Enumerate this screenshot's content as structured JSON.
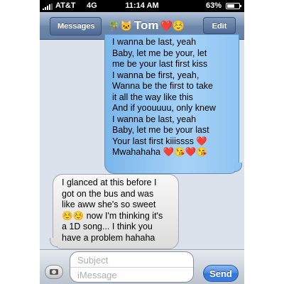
{
  "status_bar": {
    "carrier": "AT&T",
    "network": "4G",
    "time": "11:14 AM",
    "battery_percent": "63%",
    "battery_level": 0.63
  },
  "nav": {
    "back_label": "Messages",
    "title_prefix_emoji": "🎋🐱",
    "title": "Tom",
    "title_suffix_emoji": "❤️☺️",
    "edit_label": "Edit"
  },
  "messages": [
    {
      "direction": "sent",
      "text": "I wanna be last, yeah\nBaby, let me be your, let\nme be your last first kiss\nI wanna be first, yeah,\nWanna be the first to take\nit all the way like this\nAnd if yoouuuu, only knew\nI wanna be last, yeah\nBaby, let me be your last\nYour last first kiiissss ❤️\nMwahahaha ❤️😘❤️😘"
    },
    {
      "direction": "received",
      "text": "I glanced at this before I\ngot on the bus and was\nlike aww she's so sweet\n☺️☺️ now I'm thinking it's\na 1D song... I think you\nhave a problem hahaha"
    }
  ],
  "compose": {
    "subject_placeholder": "Subject",
    "message_placeholder": "iMessage",
    "send_label": "Send"
  },
  "colors": {
    "navbar": "#6c86aa",
    "sent_bubble": "#a6d2f7",
    "received_bubble": "#e6e6e6",
    "send_button": "#3c7fde"
  }
}
